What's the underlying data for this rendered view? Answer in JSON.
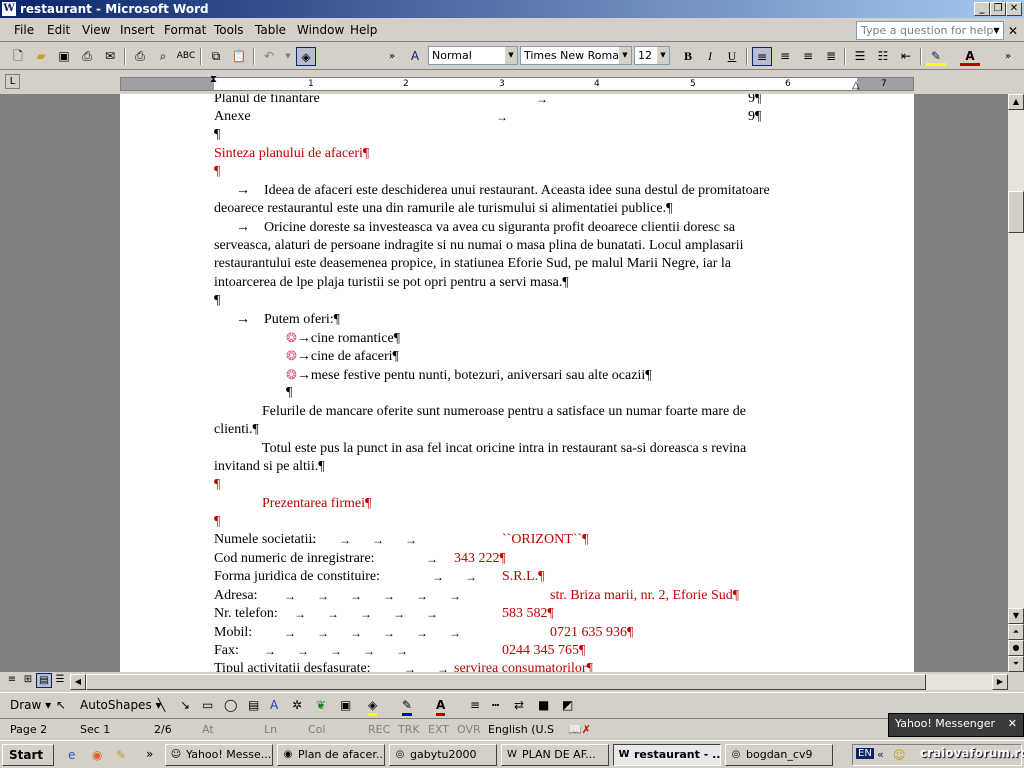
{
  "window": {
    "title": "restaurant - Microsoft Word",
    "app_icon": "W"
  },
  "menu": {
    "items": [
      "File",
      "Edit",
      "View",
      "Insert",
      "Format",
      "Tools",
      "Table",
      "Window",
      "Help"
    ],
    "help_placeholder": "Type a question for help"
  },
  "toolbar": {
    "style": "Normal",
    "font": "Times New Roman",
    "size": "12",
    "bold": "B",
    "italic": "I",
    "underline": "U"
  },
  "ruler": {
    "numbers": [
      "1",
      "2",
      "3",
      "4",
      "5",
      "6",
      "7"
    ]
  },
  "document": {
    "toc": [
      {
        "label": "Planul de finantare",
        "page": "9¶"
      },
      {
        "label": "Anexe",
        "page": "9¶"
      }
    ],
    "section1_title": "Sinteza planului de afaceri¶",
    "para1_l1": "Ideea de afaceri este deschiderea unui restaurant. Aceasta idee suna destul de promitatoare",
    "para1_l2": "deoarece restaurantul este una din ramurile ale turismului si alimentatiei publice.¶",
    "para2_l1": "Oricine doreste sa investeasca va avea cu siguranta profit deoarece clientii doresc sa",
    "para2_l2": "serveasca, alaturi de persoane indragite si nu numai o masa plina de bunatati. Locul amplasarii",
    "para2_l3": "restaurantului este deasemenea propice, in statiunea Eforie Sud, pe malul Marii Negre, iar la",
    "para2_l4": "intoarcerea de lpe plaja turistii se pot opri pentru a servi masa.¶",
    "offer_intro": "Putem oferi:¶",
    "offers": [
      "cine romantice¶",
      "cine de afaceri¶",
      "mese festive pentu nunti, botezuri, aniversari sau alte ocazii¶"
    ],
    "para3_l1": "Felurile de mancare oferite sunt numeroase pentru a satisface un numar foarte mare de",
    "para3_l2": "clienti.¶",
    "para4_l1": "Totul este pus la punct in asa fel incat oricine intra in restaurant sa-si doreasca s revina",
    "para4_l2": "invitand si pe altii.¶",
    "section2_title": "Prezentarea firmei¶",
    "pilcrow": "¶",
    "company": [
      {
        "label": "Numele societatii:",
        "value": "``ORIZONT``¶"
      },
      {
        "label": "Cod numeric de inregistrare:",
        "value": "343 222¶"
      },
      {
        "label": "Forma juridica de constituire:",
        "value": "S.R.L.¶"
      },
      {
        "label": "Adresa:",
        "value": "str. Briza marii, nr. 2, Eforie Sud¶"
      },
      {
        "label": "Nr. telefon:",
        "value": "583 582¶"
      },
      {
        "label": "Mobil:",
        "value": "0721 635 936¶"
      },
      {
        "label": "Fax:",
        "value": "0244 345 765¶"
      },
      {
        "label": "Tipul activitatii desfasurate:",
        "value": "servirea consumatorilor¶"
      }
    ]
  },
  "drawbar": {
    "draw": "Draw",
    "autoshapes": "AutoShapes"
  },
  "status": {
    "page": "Page 2",
    "sec": "Sec 1",
    "pages": "2/6",
    "at": "At",
    "ln": "Ln",
    "col": "Col",
    "rec": "REC",
    "trk": "TRK",
    "ext": "EXT",
    "ovr": "OVR",
    "lang": "English (U.S"
  },
  "yahoo_popup": "Yahoo! Messenger",
  "taskbar": {
    "start": "Start",
    "tasks": [
      "Yahoo! Messe...",
      "Plan de afacer...",
      "gabytu2000",
      "PLAN DE AF...",
      "restaurant - ...",
      "bogdan_cv9"
    ],
    "lang": "EN"
  },
  "watermark": "craiovaforum.ro",
  "colors": {
    "title_blue": "#0a246a",
    "red_text": "#c00000"
  }
}
